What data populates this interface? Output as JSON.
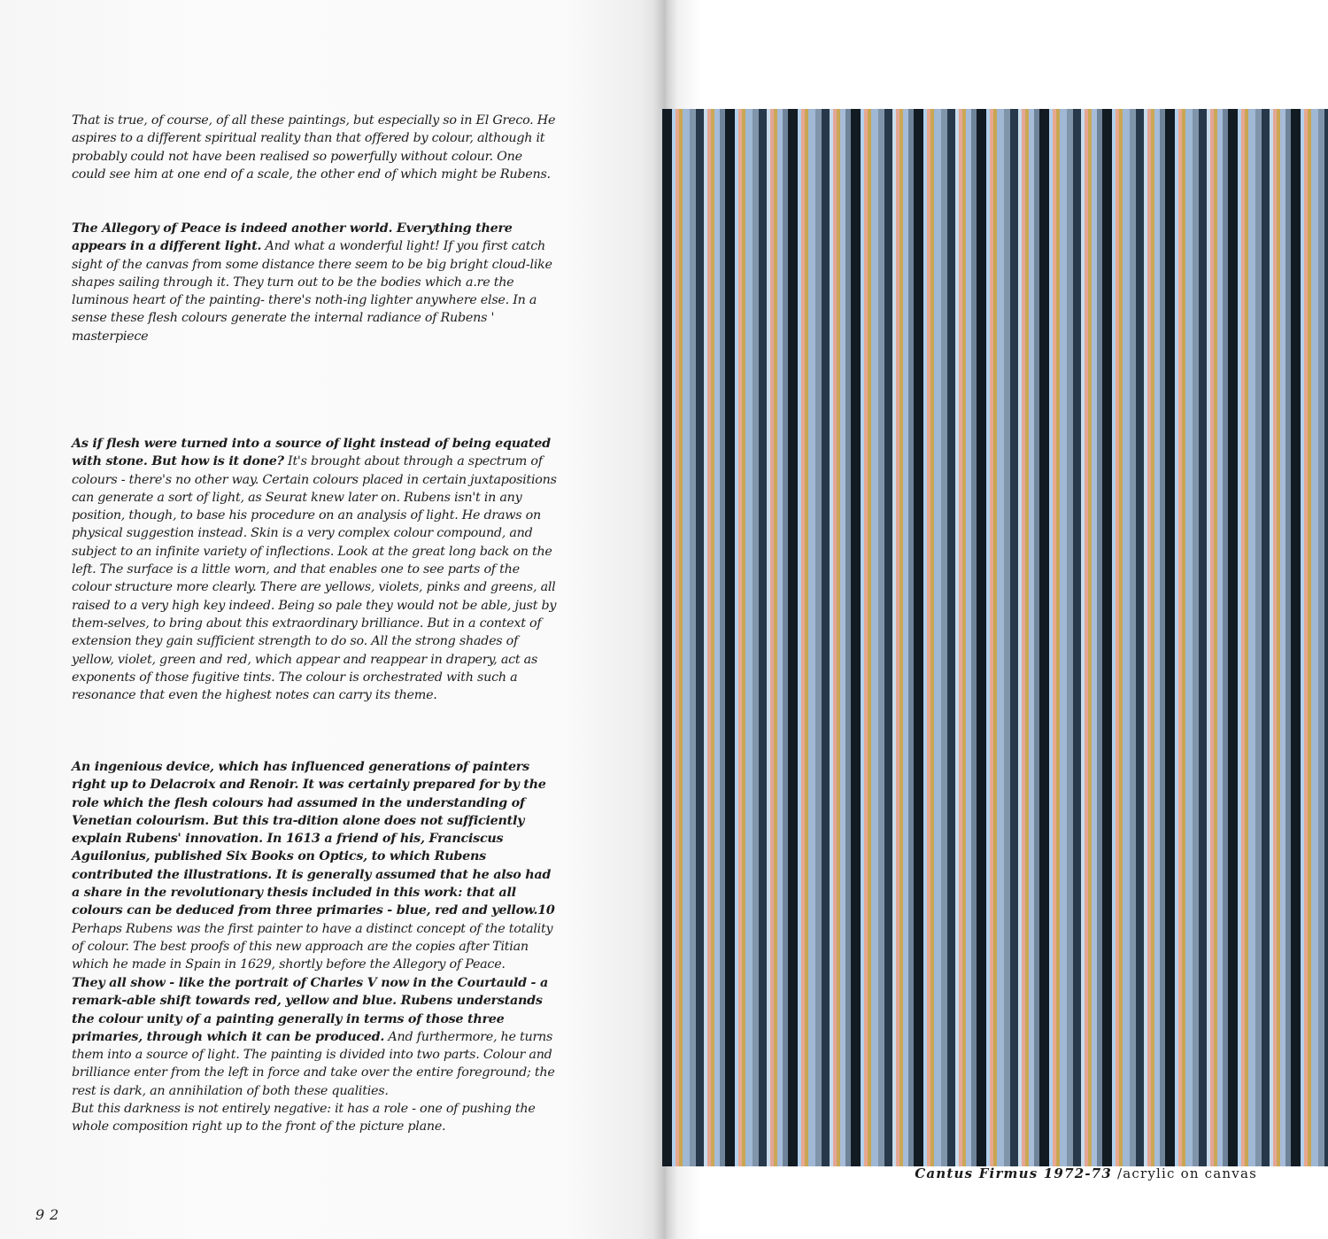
{
  "left_page": {
    "paragraphs": [
      {
        "bold": "",
        "text": "That is true, of course, of all these paintings, but especially so in El Greco. He aspires to a different spiritual reality than that offered by colour, although it probably could not have been realised so powerfully without colour. One could see him at one end of a scale, the other end of which might be Rubens."
      },
      {
        "bold": "The Allegory of Peace is indeed another world. Everything there appears in a different light.",
        "text": " And what a wonderful light! If you first catch sight of the canvas from some distance there seem to be big bright cloud-like shapes sailing through it. They turn out to be the bodies which a.re the luminous heart of the painting- there's noth-ing lighter anywhere else. In a sense these flesh colours generate the internal radiance of Rubens ' masterpiece"
      },
      {
        "bold": "As if flesh were turned into a source of light instead of being equated with stone. But how is it done?",
        "text": " It's brought about through a spectrum of colours - there's no other way. Certain colours placed in certain juxtapositions can generate a sort of light, as Seurat knew later on. Rubens isn't in any position, though, to base his procedure on an analysis of light. He draws on physical suggestion instead. Skin is a very complex colour compound, and subject to an infinite variety of inflections. Look at the great long back on the left. The surface is a little worn, and that enables one to see parts of the colour structure more clearly. There are yellows, violets, pinks and greens, all raised to a very high key indeed. Being so pale they would not be able, just by them-selves, to bring about this extraordinary brilliance. But in a context of extension they gain sufficient strength to do so. All the strong shades of yellow, violet, green and red, which appear and reappear in drapery, act as exponents of those fugitive tints. The colour is orchestrated with such a resonance that even the highest notes can carry its theme."
      },
      {
        "bold": "An ingenious device, which has influenced generations of painters right up to Delacroix and Renoir. It was certainly prepared for by the role which the flesh colours had assumed in the understanding of Venetian colourism. But this tra-dition alone does not sufficiently explain Rubens' innovation. In 1613 a friend of his, Franciscus Aguilonius, published Six Books on Optics, to which Rubens contributed the illustrations. It is generally assumed that he also had a share in the revolutionary thesis included in this work: that all colours can be deduced from three primaries - blue, red and yellow.10",
        "text": " Perhaps Rubens was the first painter to have a distinct concept of the totality of colour. The best proofs of this new approach are the copies after Titian which he made in Spain in 1629, shortly before the Allegory of Peace."
      },
      {
        "bold": "They all show - like the portrait of Charles V now in the Courtauld - a remark-able shift towards red, yellow and blue. Rubens understands the colour unity of a painting generally in terms of those three primaries, through which it can be produced.",
        "text": " And furthermore, he turns them into a source of light. The painting is divided into two parts. Colour and brilliance enter from the left in force and take over the entire foreground; the rest is dark, an annihilation of both these qualities.",
        "text2": "But this darkness is not entirely negative: it has a role - one of pushing the whole composition right up to the front of the picture plane."
      }
    ],
    "page_number": "92"
  },
  "right_page": {
    "painting": {
      "repeats": 14,
      "unit_colors": [
        "#121a22",
        "#b2d0ec",
        "#e8a890",
        "#c8a652",
        "#a0b8d4",
        "#8094aa",
        "#27384a",
        "#c8dcec",
        "#e4a696",
        "#caa856",
        "#a7bcd8",
        "#6f8399",
        "#a7bcd8"
      ]
    },
    "caption": {
      "title": "Cantus Firmus 1972-73",
      "medium": " /acrylic on canvas"
    }
  }
}
